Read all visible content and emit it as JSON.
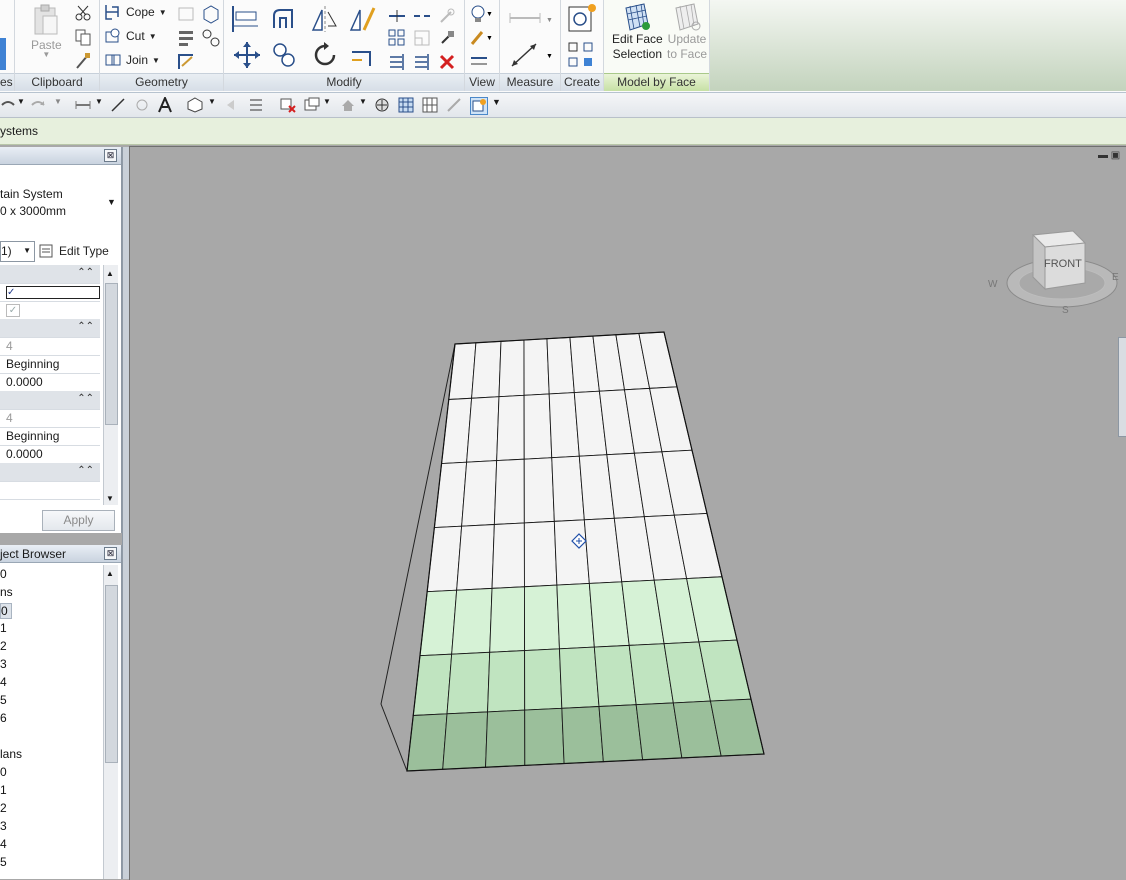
{
  "ribbon": {
    "partial_left_label": "es",
    "clipboard": {
      "label": "Clipboard",
      "paste": "Paste"
    },
    "geometry": {
      "label": "Geometry",
      "cope": "Cope",
      "cut": "Cut",
      "join": "Join"
    },
    "modify": {
      "label": "Modify"
    },
    "view": {
      "label": "View"
    },
    "measure": {
      "label": "Measure"
    },
    "create": {
      "label": "Create"
    },
    "model_by_face": {
      "label": "Model by Face",
      "edit_face_1": "Edit Face",
      "edit_face_2": "Selection",
      "update_1": "Update",
      "update_2": "to Face"
    }
  },
  "options_bar": {
    "context": "ystems"
  },
  "properties": {
    "close": "⊠",
    "type_line1": "tain System",
    "type_line2": "0 x 3000mm",
    "instance_selector": "1)",
    "edit_type": "Edit Type",
    "rows": {
      "grid1_number": "4",
      "grid1_justification": "Beginning",
      "grid1_angle": "0.0000",
      "grid2_number": "4",
      "grid2_justification": "Beginning",
      "grid2_angle": "0.0000"
    },
    "apply": "Apply"
  },
  "project_browser": {
    "title": "ject Browser",
    "close": "⊠",
    "items": [
      "0",
      "ns",
      "0",
      "1",
      "2",
      "3",
      "4",
      "5",
      "6",
      "",
      "lans",
      "0",
      "1",
      "2",
      "3",
      "4",
      "5"
    ]
  },
  "viewcube": {
    "face": "FRONT",
    "compass_w": "W",
    "compass_s": "S",
    "compass_e": "E"
  },
  "colors": {
    "viewport_bg": "#a8a8a8",
    "panel_white": "#f4f4f4",
    "panel_green_light": "#d6f2d6",
    "panel_green_dark": "#9bbf9b",
    "ribbon_green": "#c6e0a4"
  }
}
